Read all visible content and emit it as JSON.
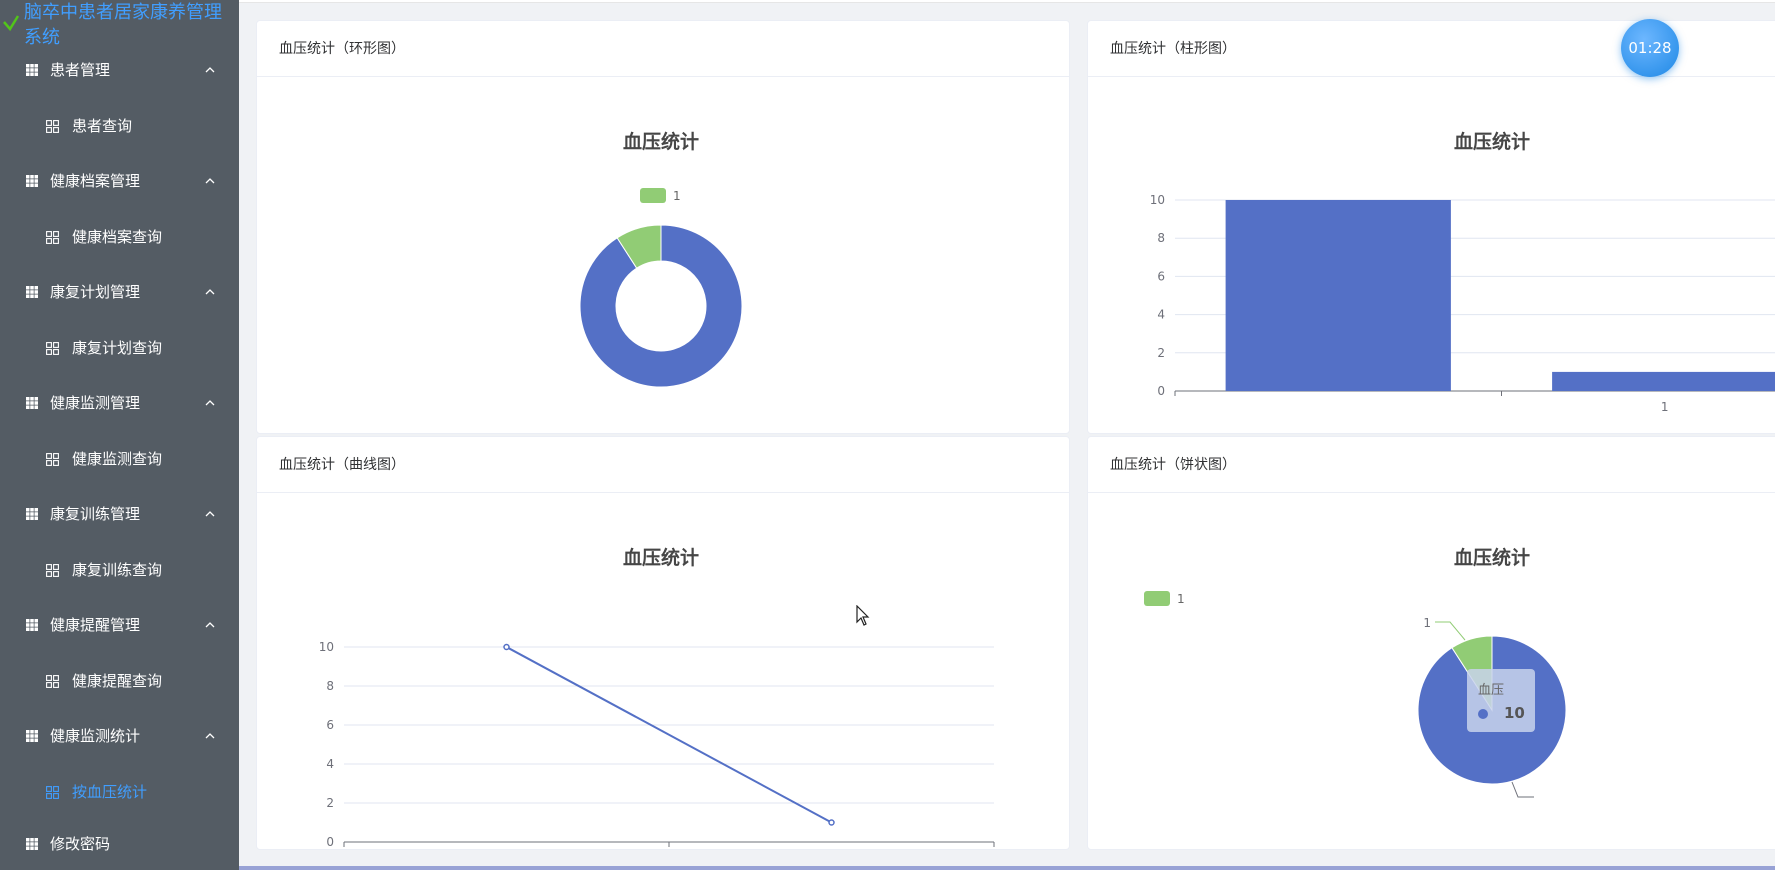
{
  "app": {
    "title": "脑卒中患者居家康养管理系统"
  },
  "sidebar": {
    "groups": [
      {
        "label": "患者管理",
        "sub": "患者查询"
      },
      {
        "label": "健康档案管理",
        "sub": "健康档案查询"
      },
      {
        "label": "康复计划管理",
        "sub": "康复计划查询"
      },
      {
        "label": "健康监测管理",
        "sub": "健康监测查询"
      },
      {
        "label": "康复训练管理",
        "sub": "康复训练查询"
      },
      {
        "label": "健康提醒管理",
        "sub": "健康提醒查询"
      },
      {
        "label": "健康监测统计",
        "sub": "按血压统计"
      }
    ],
    "bottom": {
      "label": "修改密码"
    },
    "colors": {
      "background": "#545c64",
      "active": "#409eff",
      "text": "#ffffff"
    }
  },
  "timer": "01:28",
  "cards": {
    "ring": {
      "header": "血压统计（环形图）"
    },
    "bar": {
      "header": "血压统计（柱形图）"
    },
    "line": {
      "header": "血压统计（曲线图）"
    },
    "pie": {
      "header": "血压统计（饼状图）"
    }
  },
  "tooltip": {
    "name": "血压",
    "value": "10"
  },
  "chart_data": [
    {
      "type": "pie",
      "variant": "ring",
      "title": "血压统计",
      "legend": [
        "1"
      ],
      "legend_position": "top",
      "slices": [
        {
          "label": "",
          "value": 10,
          "color": "#5470c6"
        },
        {
          "label": "1",
          "value": 1,
          "color": "#91cc75"
        }
      ]
    },
    {
      "type": "bar",
      "title": "血压统计",
      "categories": [
        "",
        "1"
      ],
      "values": [
        10,
        1
      ],
      "ylim": [
        0,
        10
      ],
      "yticks": [
        0,
        2,
        4,
        6,
        8,
        10
      ],
      "grid": true,
      "color": "#5470c6"
    },
    {
      "type": "line",
      "title": "血压统计",
      "categories": [
        "",
        "1"
      ],
      "values": [
        10,
        1
      ],
      "ylim": [
        0,
        10
      ],
      "yticks": [
        0,
        2,
        4,
        6,
        8,
        10
      ],
      "grid": true,
      "color": "#5470c6"
    },
    {
      "type": "pie",
      "title": "血压统计",
      "legend": [
        "1"
      ],
      "legend_position": "top-left",
      "slices": [
        {
          "label": "",
          "value": 10,
          "color": "#5470c6"
        },
        {
          "label": "1",
          "value": 1,
          "color": "#91cc75"
        }
      ]
    }
  ],
  "icons": {
    "group": "grid-icon",
    "sub": "apps-icon",
    "arrow": "chevron-up-icon",
    "brand": "check-icon"
  }
}
